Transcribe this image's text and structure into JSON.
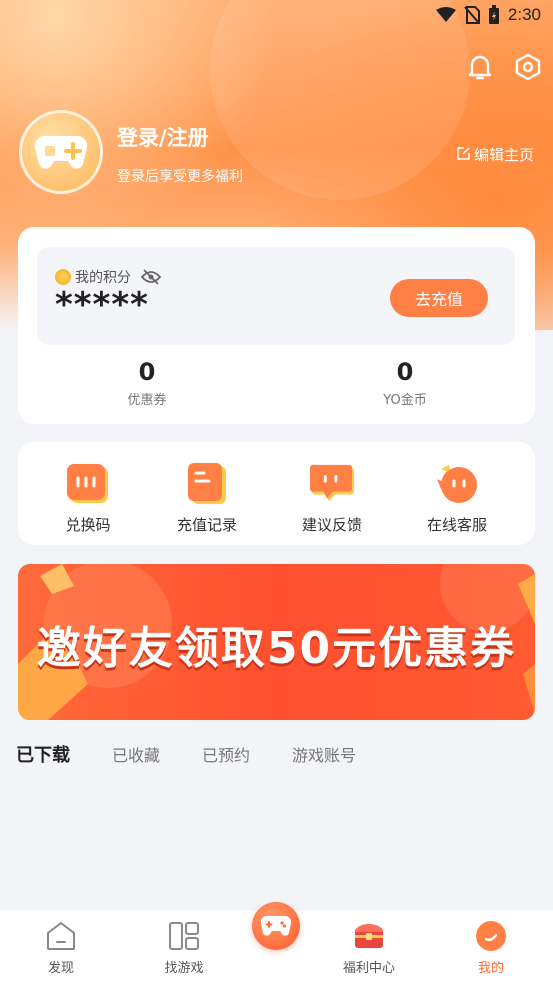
{
  "status_bar": {
    "time": "2:30",
    "icons": [
      "wifi-icon",
      "no-sim-icon",
      "battery-charging-icon"
    ]
  },
  "header": {
    "bell_icon": "bell-icon",
    "settings_icon": "hexagon-settings-icon",
    "login_title": "登录/注册",
    "login_subtitle": "登录后享受更多福利",
    "edit_home_label": "编辑主页"
  },
  "points_card": {
    "label": "我的积分",
    "value": "*****",
    "recharge_label": "去充值",
    "stats": [
      {
        "value": "0",
        "label": "优惠券"
      },
      {
        "value": "0",
        "label": "YO金币"
      }
    ]
  },
  "quick_actions": [
    {
      "label": "兑换码",
      "icon": "redeem-code-icon"
    },
    {
      "label": "充值记录",
      "icon": "recharge-record-icon"
    },
    {
      "label": "建议反馈",
      "icon": "feedback-icon"
    },
    {
      "label": "在线客服",
      "icon": "customer-service-icon"
    }
  ],
  "banner": {
    "text": "邀好友领取50元优惠券"
  },
  "tabs": [
    {
      "label": "已下载",
      "active": true
    },
    {
      "label": "已收藏",
      "active": false
    },
    {
      "label": "已预约",
      "active": false
    },
    {
      "label": "游戏账号",
      "active": false
    }
  ],
  "bottom_nav": [
    {
      "label": "发现",
      "icon": "discover-icon"
    },
    {
      "label": "找游戏",
      "icon": "find-game-icon"
    },
    {
      "label": "福利中心",
      "icon": "welfare-chest-icon"
    },
    {
      "label": "我的",
      "icon": "profile-icon",
      "active": true
    }
  ],
  "colors": {
    "accent": "#ff7f45",
    "active_nav": "#ff6a2b"
  }
}
